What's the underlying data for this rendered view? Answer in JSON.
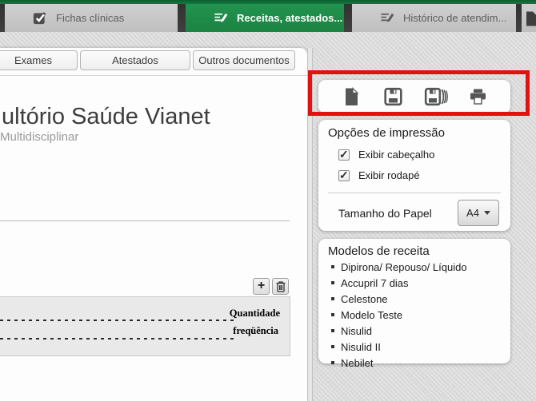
{
  "tabs": {
    "fichas": "Fichas clínicas",
    "receitas": "Receitas, atestados...",
    "historico": "Histórico de atendim..."
  },
  "subtabs": {
    "exames": "Exames",
    "atestados": "Atestados",
    "outros": "Outros documentos"
  },
  "document": {
    "title": "ultório Saúde Vianet",
    "subtitle": "Multidisciplinar",
    "qty_label": "Quantidade",
    "freq_label": "freqüência"
  },
  "toolbar": {
    "icons": [
      "new-document",
      "save",
      "save-all",
      "print"
    ]
  },
  "print_options": {
    "title": "Opções de impressão",
    "header_checkbox": "Exibir cabeçalho",
    "header_checked": true,
    "footer_checkbox": "Exibir rodapé",
    "footer_checked": true,
    "paper_label": "Tamanho do Papel",
    "paper_value": "A4"
  },
  "templates": {
    "title": "Modelos de receita",
    "items": [
      "Dipirona/ Repouso/ Líquido",
      "Accupril 7 dias",
      "Celestone",
      "Modelo Teste",
      "Nisulid",
      "Nisulid II",
      "Nebilet"
    ]
  },
  "colors": {
    "accent_green": "#1e8c4b",
    "tab_bar_dark": "#3a3a3a",
    "highlight_red": "#e01212"
  }
}
